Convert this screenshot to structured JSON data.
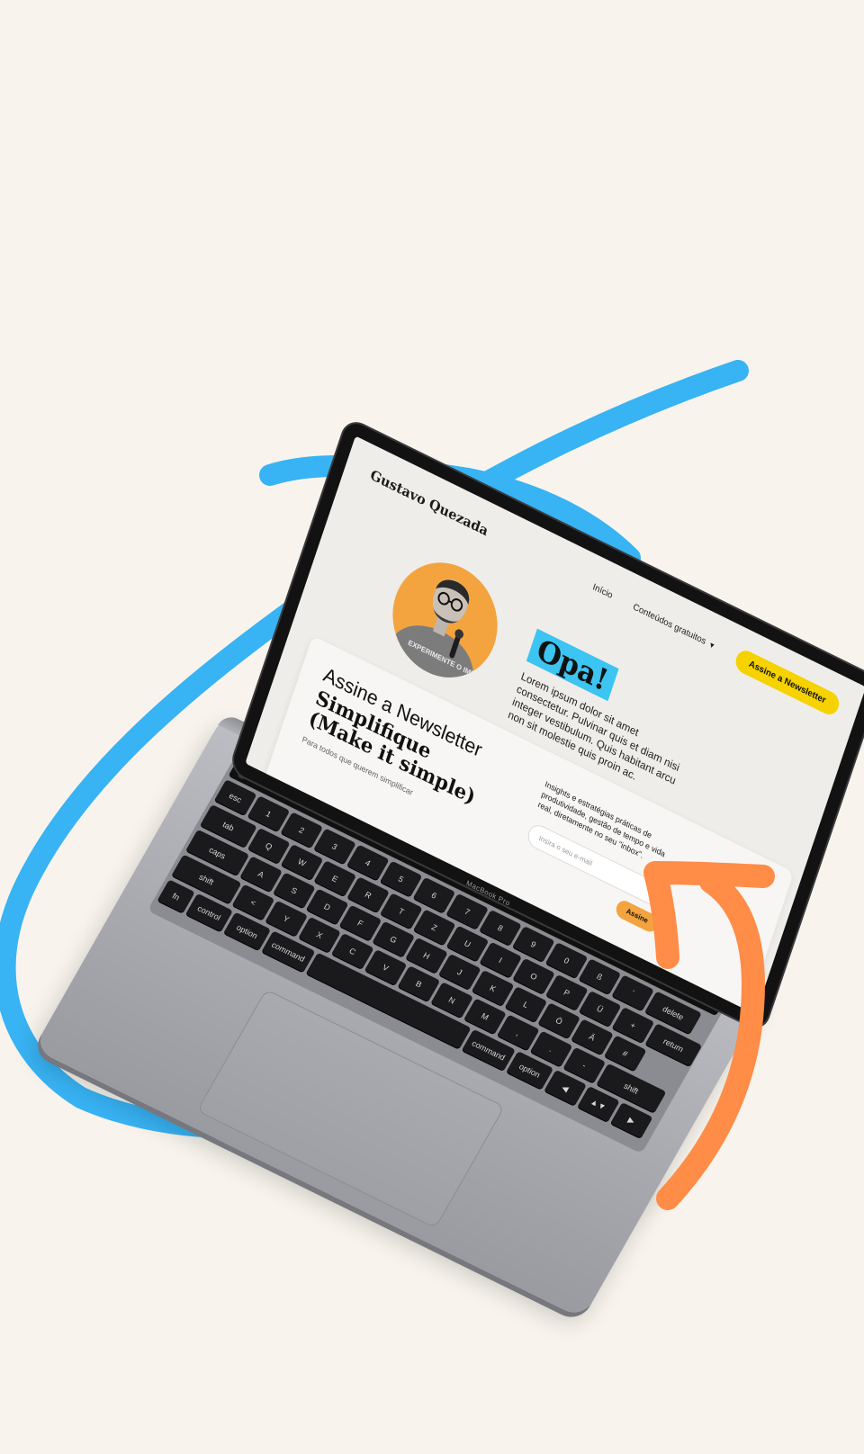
{
  "site": {
    "brand": "Gustavo Quezada",
    "nav": {
      "home": "Início",
      "free_content": "Conteúdos gratuitos",
      "cta": "Assine a Newsletter"
    },
    "hero": {
      "title": "Opa!",
      "body": "Lorem ipsum dolor sit amet consectetur. Pulvinar quis et diam nisi integer vestibulum. Quis habitant arcu non sit molestie quis proin ac.",
      "shirt_text": "EXPERIMENTE O IMPOSSÍVEL"
    },
    "newsletter": {
      "kicker": "Assine a Newsletter",
      "title": "Simplifique (Make it simple)",
      "description": "Para todos que querem simplificar",
      "text": "Insights e estratégias práticas de produtividade, gestão de tempo e vida real, diretamente no seu \"inbox\".",
      "email_placeholder": "Insira o seu e-mail",
      "submit": "Assine"
    }
  },
  "device": {
    "lid_label": "MacBook Pro",
    "keyboard_rows": [
      [
        "esc",
        "1",
        "2",
        "3",
        "4",
        "5",
        "6",
        "7",
        "8",
        "9",
        "0",
        "ß",
        "´",
        "delete"
      ],
      [
        "tab",
        "Q",
        "W",
        "E",
        "R",
        "T",
        "Z",
        "U",
        "I",
        "O",
        "P",
        "Ü",
        "+",
        "return"
      ],
      [
        "caps",
        "A",
        "S",
        "D",
        "F",
        "G",
        "H",
        "J",
        "K",
        "L",
        "Ö",
        "Ä",
        "#"
      ],
      [
        "shift",
        "<",
        "Y",
        "X",
        "C",
        "V",
        "B",
        "N",
        "M",
        ",",
        ".",
        "-",
        "shift"
      ],
      [
        "fn",
        "control",
        "option",
        "command",
        "",
        "command",
        "option",
        "◀",
        "▲▼",
        "▶"
      ]
    ]
  },
  "colors": {
    "background": "#f8f4ed",
    "blue_stroke": "#38b3f4",
    "orange_arrow": "#ff8c47",
    "highlight": "#3cc4f2",
    "cta_yellow": "#f5d200",
    "submit_orange": "#f3a43f",
    "avatar_bg": "#f3a43f"
  }
}
